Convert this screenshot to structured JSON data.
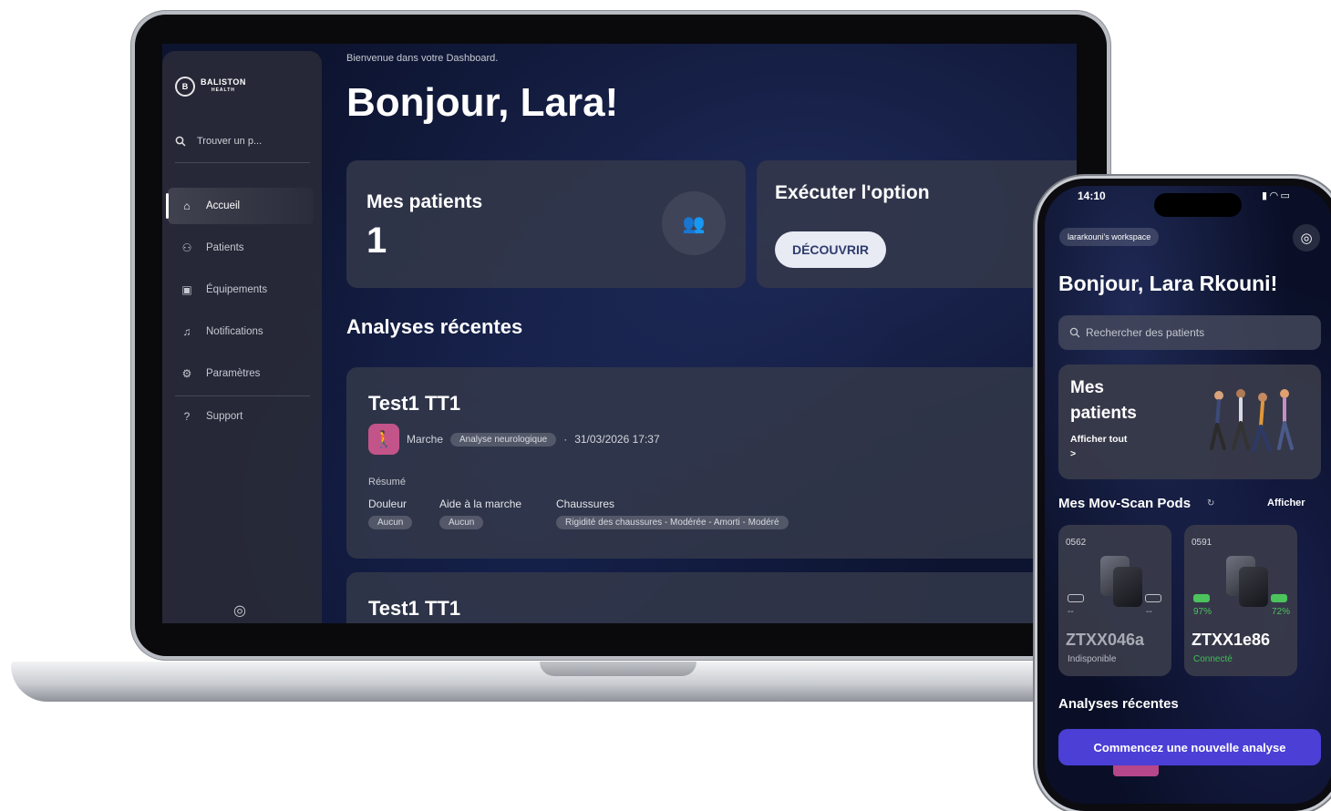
{
  "laptop": {
    "sidebar": {
      "logo": "BALISTON",
      "logo_sub": "HEALTH",
      "search_placeholder": "Trouver un p...",
      "items": [
        {
          "label": "Accueil",
          "icon": "home-icon",
          "active": true
        },
        {
          "label": "Patients",
          "icon": "patients-icon",
          "active": false
        },
        {
          "label": "Équipements",
          "icon": "equipment-icon",
          "active": false
        },
        {
          "label": "Notifications",
          "icon": "bell-icon",
          "active": false
        },
        {
          "label": "Paramètres",
          "icon": "gear-icon",
          "active": false
        },
        {
          "label": "Support",
          "icon": "help-icon",
          "active": false
        }
      ]
    },
    "main": {
      "welcome": "Bienvenue dans votre Dashboard.",
      "greeting": "Bonjour, Lara!",
      "patients_card": {
        "title": "Mes patients",
        "count": "1"
      },
      "option_card": {
        "title": "Exécuter l'option",
        "button": "DÉCOUVRIR"
      },
      "recent_title": "Analyses récentes",
      "analyses": [
        {
          "name": "Test1 TT1",
          "type": "Marche",
          "category": "Analyse neurologique",
          "datetime": "31/03/2026 17:37",
          "summary_label": "Résumé",
          "fields": [
            {
              "label": "Douleur",
              "value": "Aucun"
            },
            {
              "label": "Aide à la marche",
              "value": "Aucun"
            },
            {
              "label": "Chaussures",
              "value": "Rigidité des chaussures - Modérée - Amorti - Modéré"
            }
          ]
        },
        {
          "name": "Test1 TT1"
        }
      ]
    }
  },
  "phone": {
    "status_time": "14:10",
    "workspace": "lararkouni's workspace",
    "greeting": "Bonjour, Lara Rkouni!",
    "search_placeholder": "Rechercher des patients",
    "patients_card": {
      "title": "Mes patients",
      "link": "Afficher tout",
      "arrow": ">"
    },
    "pods_title": "Mes Mov-Scan Pods",
    "pods_link": "Afficher",
    "pods": [
      {
        "id": "0562",
        "left_batt": "--",
        "right_batt": "--",
        "name": "ZTXX046a",
        "status": "Indisponible",
        "status_color": "#b9bbc3"
      },
      {
        "id": "0591",
        "left_batt": "97%",
        "right_batt": "72%",
        "name": "ZTXX1e86",
        "status": "Connecté",
        "status_color": "#3fbf57"
      }
    ],
    "analyses_title": "Analyses récentes",
    "cta": "Commencez une nouvelle analyse"
  }
}
